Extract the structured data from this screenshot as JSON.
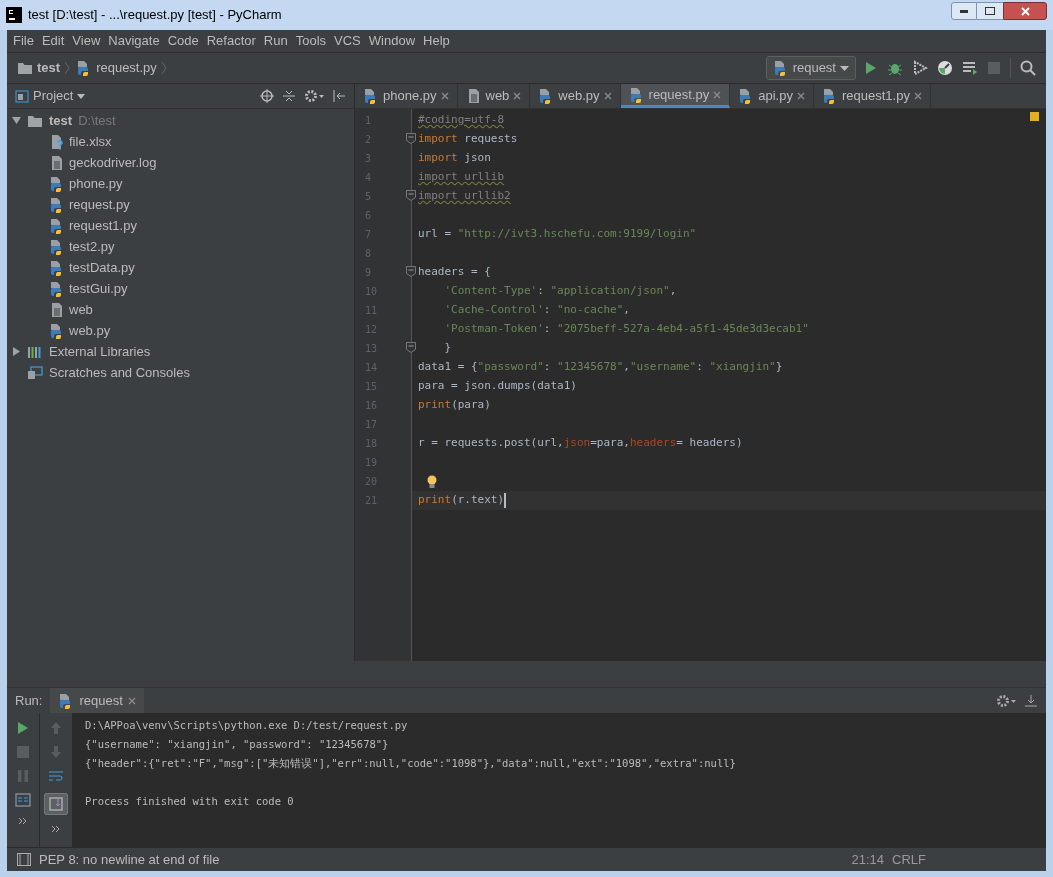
{
  "window": {
    "title": "test [D:\\test] - ...\\request.py [test] - PyCharm"
  },
  "menu": [
    "File",
    "Edit",
    "View",
    "Navigate",
    "Code",
    "Refactor",
    "Run",
    "Tools",
    "VCS",
    "Window",
    "Help"
  ],
  "breadcrumbs": [
    {
      "label": "test",
      "kind": "folder"
    },
    {
      "label": "request.py",
      "kind": "python"
    }
  ],
  "run_config": "request",
  "project_pane": {
    "title": "Project"
  },
  "tree": [
    {
      "label": "test",
      "path": "D:\\test",
      "kind": "folder",
      "expanded": true,
      "children": [
        {
          "label": "file.xlsx",
          "kind": "unknown"
        },
        {
          "label": "geckodriver.log",
          "kind": "text"
        },
        {
          "label": "phone.py",
          "kind": "python"
        },
        {
          "label": "request.py",
          "kind": "python"
        },
        {
          "label": "request1.py",
          "kind": "python"
        },
        {
          "label": "test2.py",
          "kind": "python"
        },
        {
          "label": "testData.py",
          "kind": "python"
        },
        {
          "label": "testGui.py",
          "kind": "python"
        },
        {
          "label": "web",
          "kind": "text"
        },
        {
          "label": "web.py",
          "kind": "python"
        }
      ]
    },
    {
      "label": "External Libraries",
      "kind": "library",
      "expanded": false
    },
    {
      "label": "Scratches and Consoles",
      "kind": "scratches"
    }
  ],
  "tabs": [
    {
      "label": "phone.py",
      "kind": "python",
      "selected": false
    },
    {
      "label": "web",
      "kind": "text",
      "selected": false
    },
    {
      "label": "web.py",
      "kind": "python",
      "selected": false
    },
    {
      "label": "request.py",
      "kind": "python",
      "selected": true
    },
    {
      "label": "api.py",
      "kind": "python",
      "selected": false
    },
    {
      "label": "request1.py",
      "kind": "python",
      "selected": false
    }
  ],
  "editor": {
    "lines": [
      {
        "number": "1",
        "fold": false,
        "bulb": false,
        "current": false,
        "tokens": [
          {
            "kind": "comment",
            "text": "#coding=utf-8"
          }
        ]
      },
      {
        "number": "2",
        "fold": true,
        "bulb": false,
        "current": false,
        "tokens": [
          {
            "kind": "keyword",
            "text": "import"
          },
          {
            "kind": "plain",
            "text": " requests"
          }
        ]
      },
      {
        "number": "3",
        "fold": false,
        "bulb": false,
        "current": false,
        "tokens": [
          {
            "kind": "keyword",
            "text": "import"
          },
          {
            "kind": "plain",
            "text": " json"
          }
        ]
      },
      {
        "number": "4",
        "fold": false,
        "bulb": false,
        "current": false,
        "tokens": [
          {
            "kind": "unused",
            "text": "import urllib"
          }
        ]
      },
      {
        "number": "5",
        "fold": true,
        "bulb": false,
        "current": false,
        "tokens": [
          {
            "kind": "unused",
            "text": "import urllib2"
          }
        ]
      },
      {
        "number": "6",
        "fold": false,
        "bulb": false,
        "current": false
      },
      {
        "number": "7",
        "fold": false,
        "bulb": false,
        "current": false,
        "tokens": [
          {
            "kind": "plain",
            "text": "url = "
          },
          {
            "kind": "string",
            "text": "\"http://ivt3.hschefu.com:9199/login\""
          }
        ]
      },
      {
        "number": "8",
        "fold": false,
        "bulb": false,
        "current": false
      },
      {
        "number": "9",
        "fold": true,
        "bulb": false,
        "current": false,
        "tokens": [
          {
            "kind": "plain",
            "text": "headers = {"
          }
        ]
      },
      {
        "number": "10",
        "fold": false,
        "bulb": false,
        "current": false,
        "tokens": [
          {
            "kind": "string",
            "text": "    'Content-Type'"
          },
          {
            "kind": "plain",
            "text": ": "
          },
          {
            "kind": "string",
            "text": "\"application/json\""
          },
          {
            "kind": "plain",
            "text": ","
          }
        ]
      },
      {
        "number": "11",
        "fold": false,
        "bulb": false,
        "current": false,
        "tokens": [
          {
            "kind": "string",
            "text": "    'Cache-Control'"
          },
          {
            "kind": "plain",
            "text": ": "
          },
          {
            "kind": "string",
            "text": "\"no-cache\""
          },
          {
            "kind": "plain",
            "text": ","
          }
        ]
      },
      {
        "number": "12",
        "fold": false,
        "bulb": false,
        "current": false,
        "tokens": [
          {
            "kind": "string",
            "text": "    'Postman-Token'"
          },
          {
            "kind": "plain",
            "text": ": "
          },
          {
            "kind": "string",
            "text": "\"2075beff-527a-4eb4-a5f1-45de3d3ecab1\""
          }
        ]
      },
      {
        "number": "13",
        "fold": true,
        "bulb": false,
        "current": false,
        "tokens": [
          {
            "kind": "plain",
            "text": "    }"
          }
        ]
      },
      {
        "number": "14",
        "fold": false,
        "bulb": false,
        "current": false,
        "tokens": [
          {
            "kind": "plain",
            "text": "data1 = {"
          },
          {
            "kind": "string",
            "text": "\"password\""
          },
          {
            "kind": "plain",
            "text": ": "
          },
          {
            "kind": "string",
            "text": "\"12345678\""
          },
          {
            "kind": "plain",
            "text": ","
          },
          {
            "kind": "string",
            "text": "\"username\""
          },
          {
            "kind": "plain",
            "text": ": "
          },
          {
            "kind": "string",
            "text": "\"xiangjin\""
          },
          {
            "kind": "plain",
            "text": "}"
          }
        ]
      },
      {
        "number": "15",
        "fold": false,
        "bulb": false,
        "current": false,
        "tokens": [
          {
            "kind": "plain",
            "text": "para = json.dumps(data1)"
          }
        ]
      },
      {
        "number": "16",
        "fold": false,
        "bulb": false,
        "current": false,
        "tokens": [
          {
            "kind": "keyword",
            "text": "print"
          },
          {
            "kind": "plain",
            "text": "(para)"
          }
        ]
      },
      {
        "number": "17",
        "fold": false,
        "bulb": false,
        "current": false
      },
      {
        "number": "18",
        "fold": false,
        "bulb": false,
        "current": false,
        "tokens": [
          {
            "kind": "plain",
            "text": "r = requests.post(url,"
          },
          {
            "kind": "param",
            "text": "json"
          },
          {
            "kind": "plain",
            "text": "=para,"
          },
          {
            "kind": "param",
            "text": "headers"
          },
          {
            "kind": "plain",
            "text": "= headers)"
          }
        ]
      },
      {
        "number": "19",
        "fold": false,
        "bulb": false,
        "current": false
      },
      {
        "number": "20",
        "fold": false,
        "bulb": true,
        "current": false
      },
      {
        "number": "21",
        "fold": false,
        "bulb": false,
        "current": true,
        "tokens": [
          {
            "kind": "keyword",
            "text": "print"
          },
          {
            "kind": "plain",
            "text": "(r.text)"
          }
        ]
      }
    ]
  },
  "run_panel": {
    "title": "Run:",
    "tab": "request",
    "output": [
      {
        "kind": "command",
        "text": "D:\\APPoa\\venv\\Scripts\\python.exe D:/test/request.py"
      },
      {
        "kind": "stdout",
        "text": "{\"username\": \"xiangjin\", \"password\": \"12345678\"}"
      },
      {
        "kind": "stdout",
        "text": "{\"header\":{\"ret\":\"F\",\"msg\":[\"未知错误\"],\"err\":null,\"code\":\"1098\"},\"data\":null,\"ext\":\"1098\",\"extra\":null}"
      },
      {
        "kind": "exit",
        "text": "Process finished with exit code 0"
      }
    ]
  },
  "status_bar": {
    "message": "PEP 8: no newline at end of file",
    "position": "21:14",
    "line_separator": "CRLF"
  }
}
